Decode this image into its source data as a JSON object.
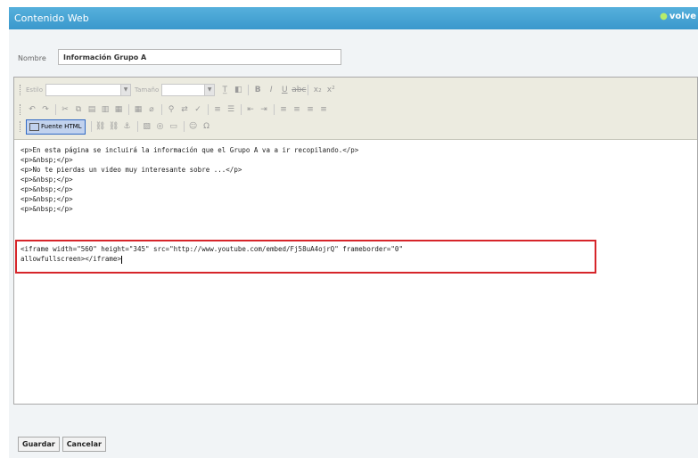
{
  "header": {
    "title": "Contenido Web",
    "back_label": "volve"
  },
  "form": {
    "name_label": "Nombre",
    "name_value": "Información Grupo A"
  },
  "toolbar": {
    "style_label": "Estilo",
    "size_label": "Tamaño",
    "source_button_label": "Fuente HTML",
    "row1_buttons": [
      "text-color",
      "background-color",
      "bold",
      "italic",
      "underline",
      "strikethrough",
      "subscript",
      "superscript"
    ],
    "row2_buttons": [
      "undo",
      "redo",
      "cut",
      "copy",
      "paste",
      "paste-text",
      "paste-word",
      "table",
      "remove-format",
      "find",
      "replace",
      "spellcheck",
      "numbered-list",
      "bulleted-list",
      "outdent",
      "indent",
      "align-left",
      "align-center",
      "align-right",
      "justify"
    ],
    "row3_buttons": [
      "link",
      "unlink",
      "anchor",
      "image",
      "flash",
      "horizontal-rule",
      "smiley",
      "special-char"
    ]
  },
  "editor": {
    "lines": [
      "<p>En esta página se incluirá la información que el Grupo A va a ir recopilando.</p>",
      "<p>&nbsp;</p>",
      "<p>No te pierdas un video muy interesante sobre ...</p>",
      "<p>&nbsp;</p>",
      "<p>&nbsp;</p>",
      "<p>&nbsp;</p>",
      "<p>&nbsp;</p>"
    ],
    "iframe_line1": "<iframe width=\"560\" height=\"345\" src=\"http://www.youtube.com/embed/Fj58uA4ojrQ\" frameborder=\"0\"",
    "iframe_line2": "allowfullscreen></iframe>"
  },
  "actions": {
    "save_label": "Guardar",
    "cancel_label": "Cancelar"
  },
  "colors": {
    "header": "#3a98cc",
    "highlight_border": "#d6252a"
  }
}
